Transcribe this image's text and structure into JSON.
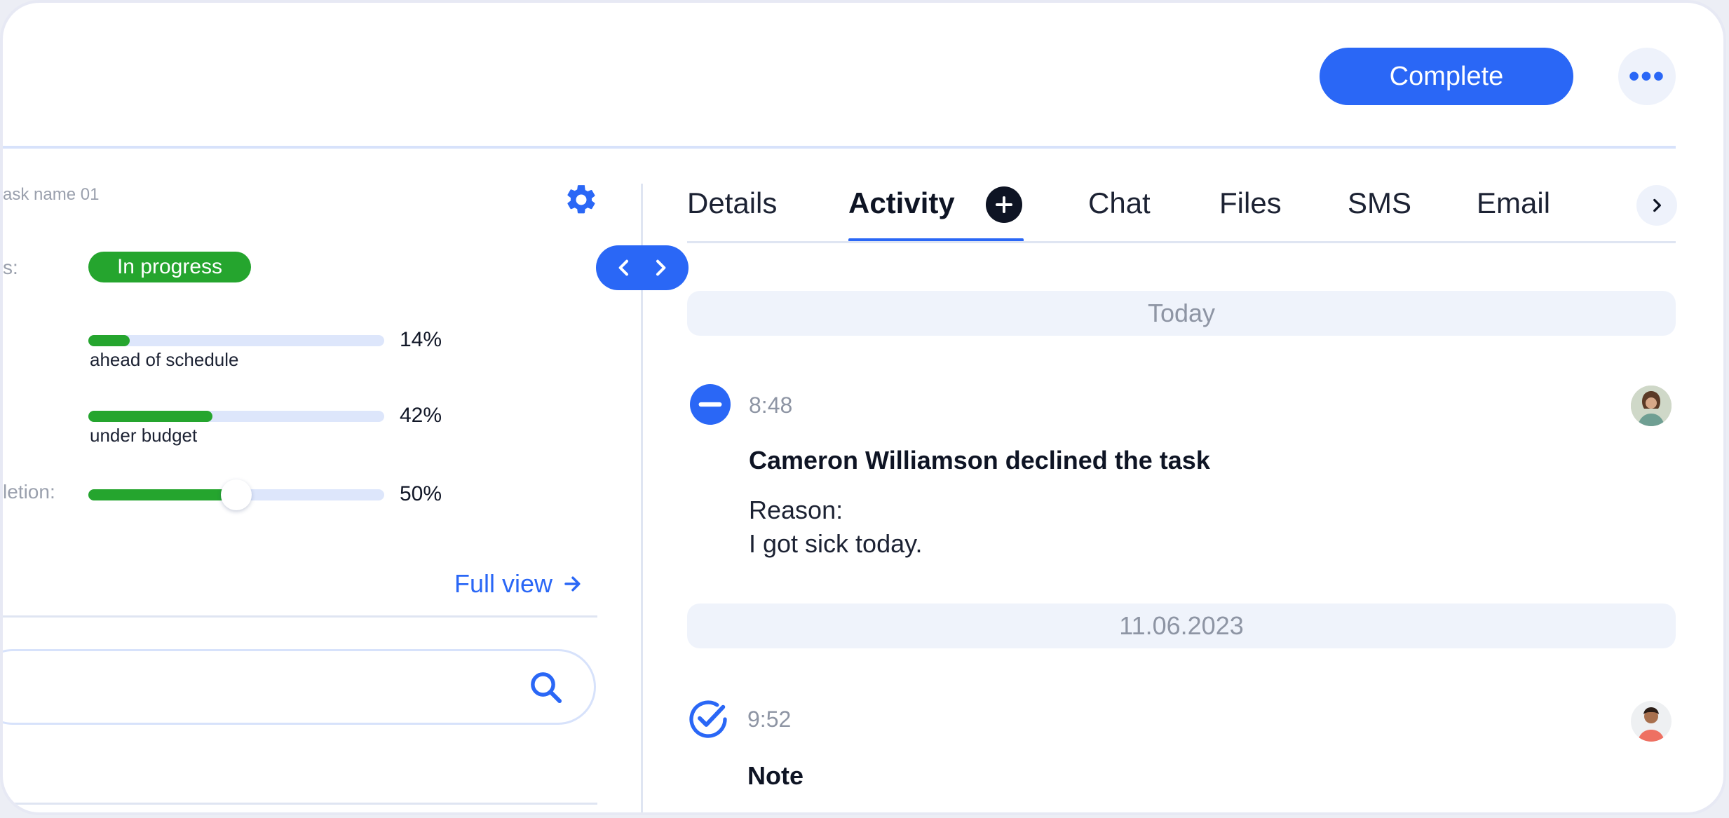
{
  "header": {
    "complete_label": "Complete",
    "more_label": "•••"
  },
  "task": {
    "name": "ask name 01",
    "status_label": "s:",
    "status": "In progress",
    "progress": [
      {
        "value": 0.14,
        "percent_label": "14%",
        "caption": "ahead of schedule"
      },
      {
        "value": 0.42,
        "percent_label": "42%",
        "caption": "under budget"
      }
    ],
    "completion_label": "letion:",
    "completion": {
      "value": 0.5,
      "percent_label": "50%"
    },
    "full_view_label": "Full view",
    "search_placeholder": ""
  },
  "tabs": [
    {
      "label": "Details",
      "active": false
    },
    {
      "label": "Activity",
      "active": true
    },
    {
      "label": "Chat",
      "active": false
    },
    {
      "label": "Files",
      "active": false
    },
    {
      "label": "SMS",
      "active": false
    },
    {
      "label": "Email",
      "active": false
    }
  ],
  "activity": {
    "groups": [
      {
        "date": "Today",
        "events": [
          {
            "icon": "minus-circle-icon",
            "time": "8:48",
            "title": "Cameron Williamson declined the task",
            "lines": [
              "Reason:",
              "I got sick today."
            ]
          }
        ]
      },
      {
        "date": "11.06.2023",
        "events": [
          {
            "icon": "check-circle-icon",
            "time": "9:52",
            "title": "Note",
            "lines": []
          }
        ]
      }
    ]
  },
  "colors": {
    "accent": "#2a67f6",
    "success": "#25a52e",
    "track": "#dde6fb",
    "dark": "#0e1424"
  }
}
